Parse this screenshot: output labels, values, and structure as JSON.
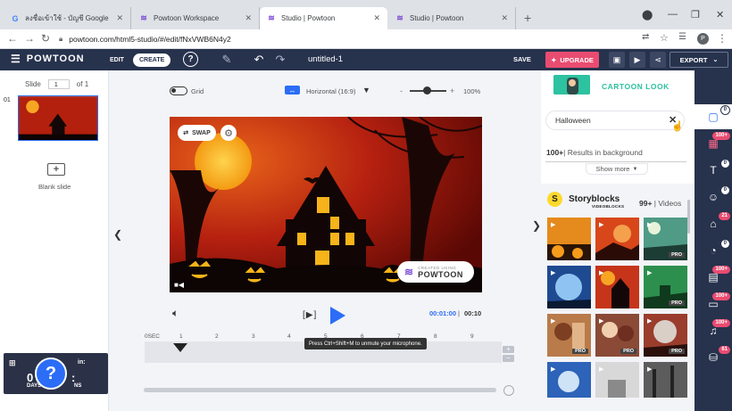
{
  "browser": {
    "tabs": [
      {
        "label": "ลงชื่อเข้าใช้ - บัญชี Google",
        "icon": "google-icon"
      },
      {
        "label": "Powtoon Workspace",
        "icon": "powtoon-icon"
      },
      {
        "label": "Studio | Powtoon",
        "icon": "powtoon-icon",
        "active": true
      },
      {
        "label": "Studio | Powtoon",
        "icon": "powtoon-icon"
      }
    ],
    "url": "powtoon.com/html5-studio/#/edit/fNxVWB6N4y2",
    "profile_initial": "P"
  },
  "toolbar": {
    "logo": "POWTOON",
    "edit_label": "EDIT",
    "create_label": "CREATE",
    "help": "?",
    "title": "untitled-1",
    "save_label": "SAVE",
    "upgrade_label": "UPGRADE",
    "export_label": "EXPORT"
  },
  "slides": {
    "label": "Slide",
    "current": "1",
    "of_label": "of 1",
    "thumb_number": "01",
    "blank_label": "Blank slide"
  },
  "stage": {
    "grid_label": "Grid",
    "orientation_label": "Horizontal (16:9)",
    "zoom_minus": "-",
    "zoom_plus": "+",
    "zoom_value": "100%",
    "swap_label": "SWAP",
    "made_with_small": "CREATED USING",
    "made_with_brand": "POWTOON"
  },
  "playback": {
    "frame_label": "[▶]",
    "time_current": "00:01:00",
    "time_sep": "|",
    "time_total": "00:10",
    "ticks": [
      "0SEC",
      "1",
      "2",
      "3",
      "4",
      "5",
      "6",
      "7",
      "8",
      "9"
    ],
    "tooltip": "Press Ctrl+Shift+M to unmute your microphone."
  },
  "help_widget": {
    "symbol": "?",
    "in_label": "in:",
    "days_label": "DAYS",
    "mins_label": "NS",
    "zero": "0"
  },
  "library": {
    "look_label": "CARTOON LOOK",
    "search_value": "Halloween",
    "results_count": "100+",
    "results_text": "Results in background",
    "show_more": "Show more",
    "provider_name": "Storyblocks",
    "provider_sub": "VIDEOBLOCKS",
    "provider_count": "99+",
    "provider_type": "Videos",
    "pro_label": "PRO"
  },
  "strip": {
    "badges": [
      "0",
      "100+",
      "0",
      "0",
      "21",
      "0",
      "100+",
      "100+",
      "100+",
      "61"
    ]
  }
}
